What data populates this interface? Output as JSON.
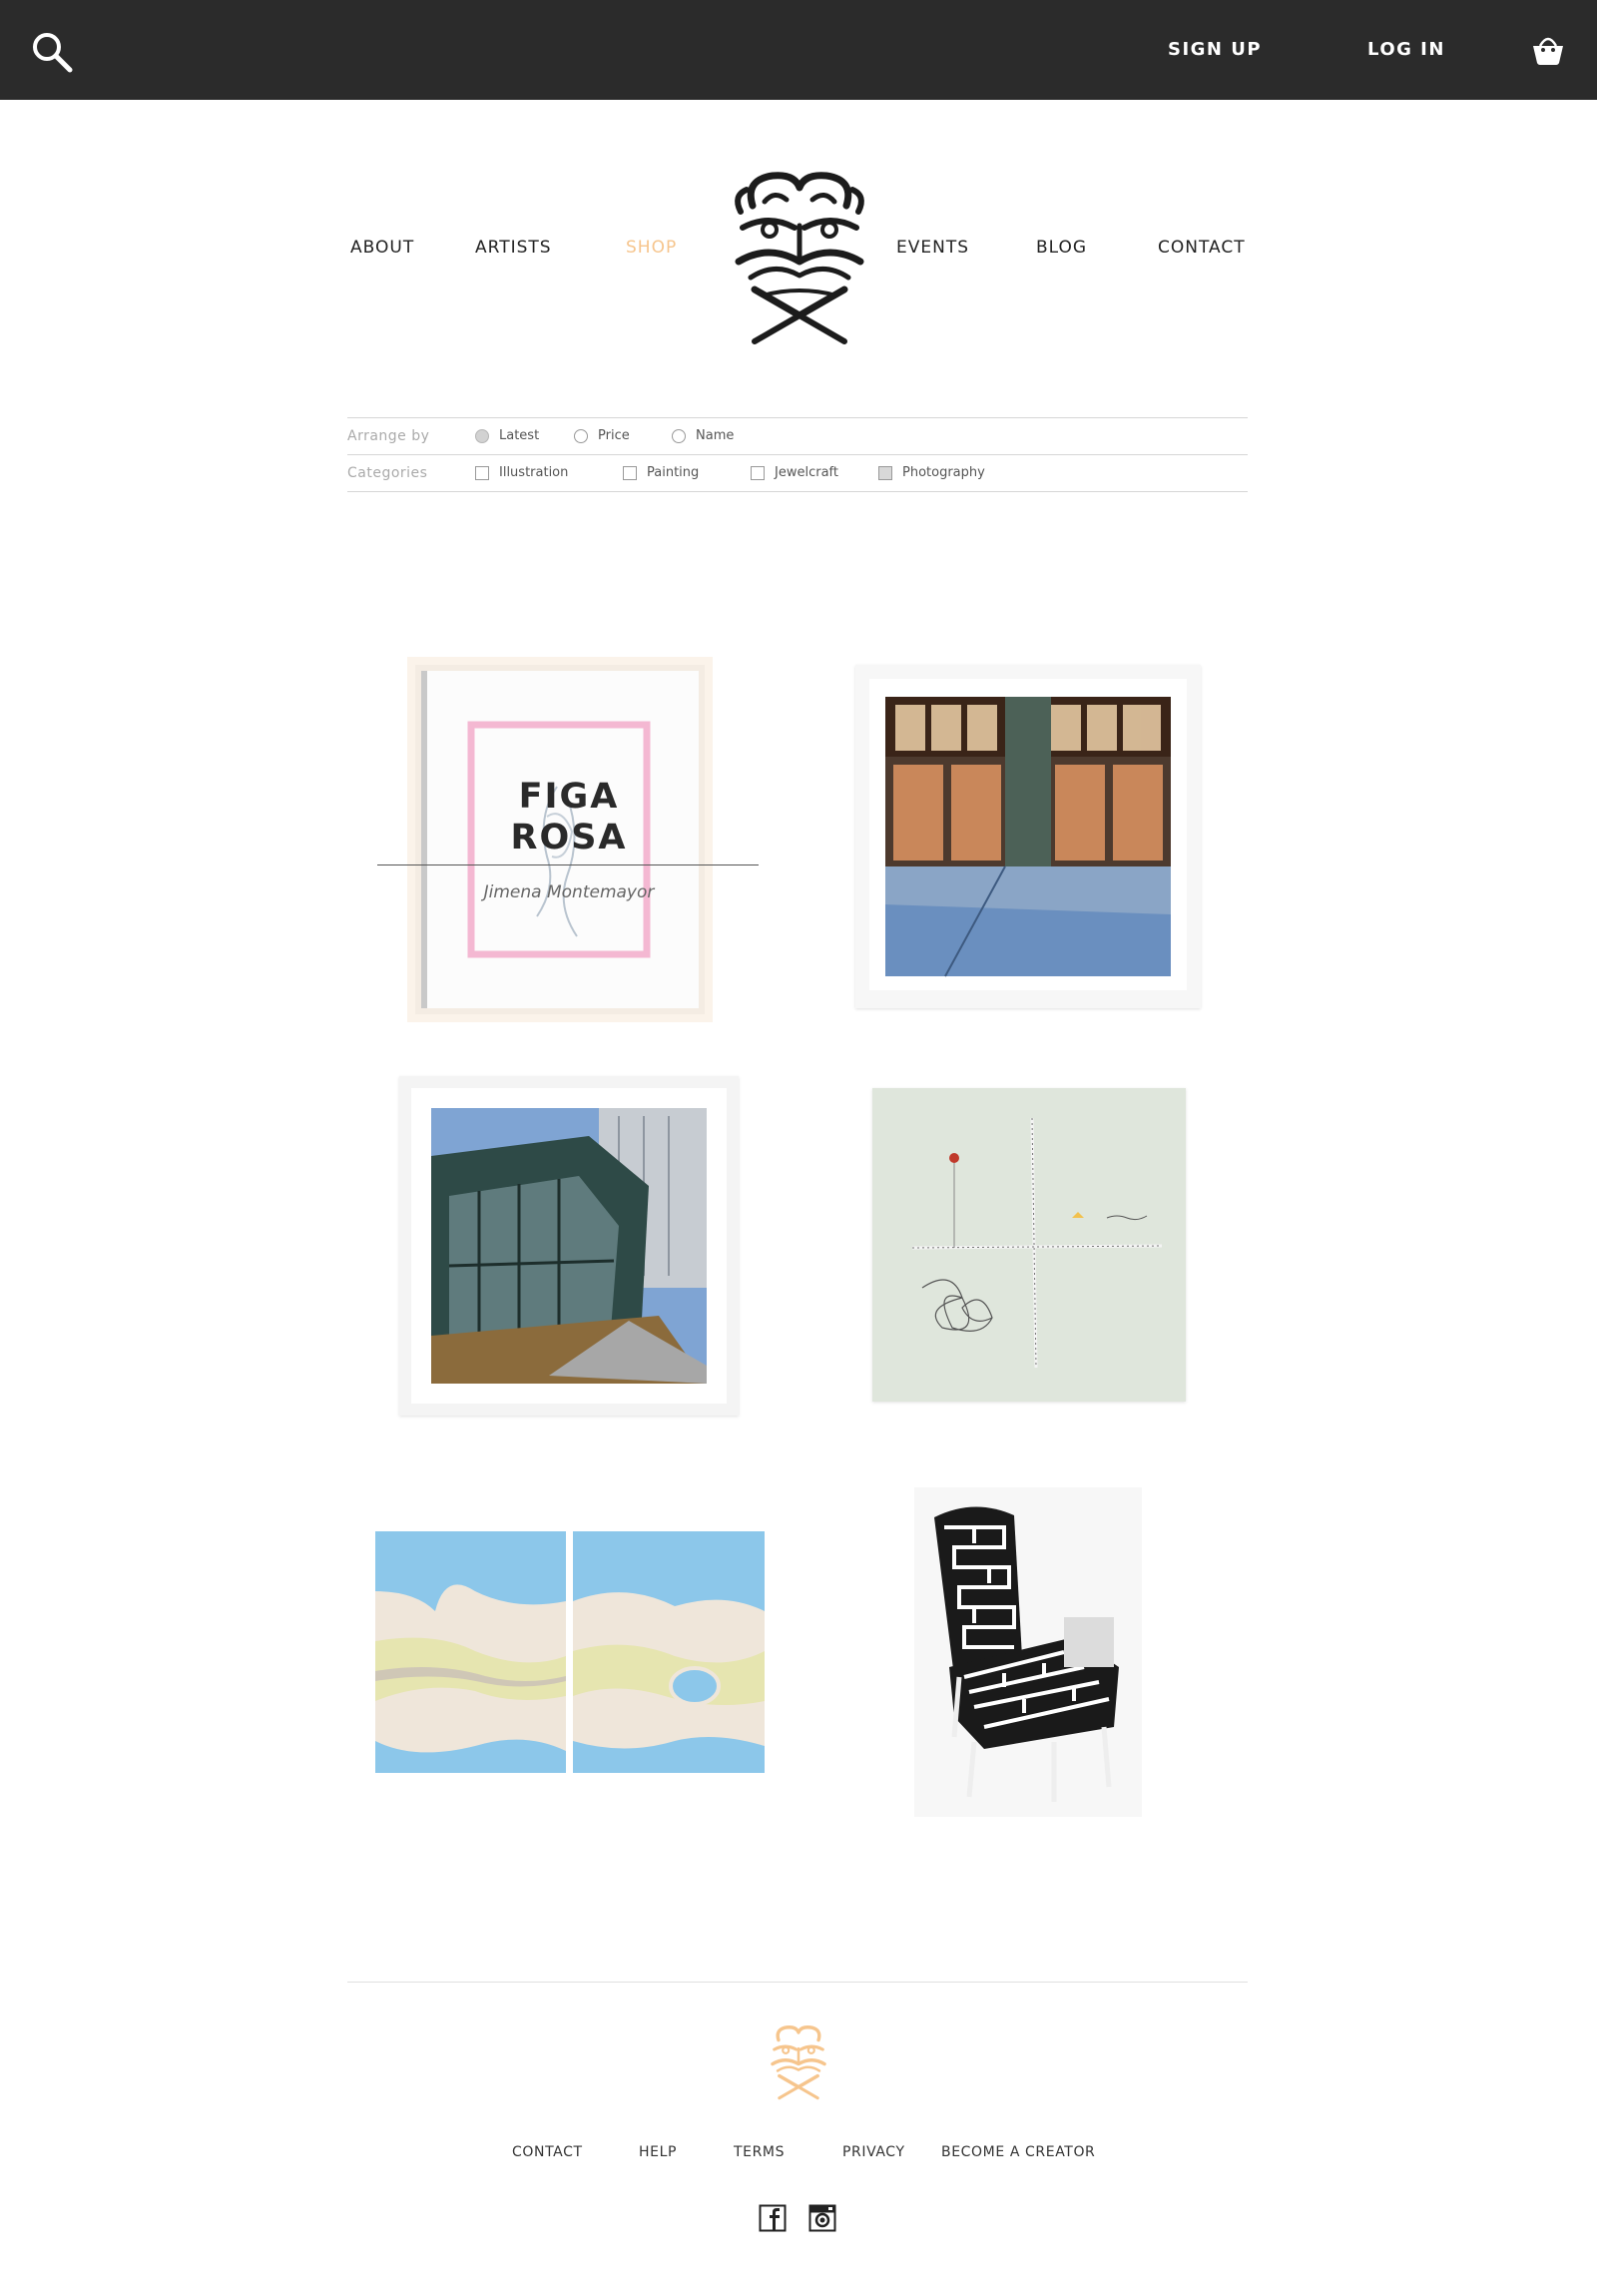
{
  "topbar": {
    "signup_label": "SIGN UP",
    "login_label": "LOG IN",
    "icons": [
      "search-icon",
      "basket-icon"
    ]
  },
  "nav": {
    "items": [
      "ABOUT",
      "ARTISTS",
      "SHOP",
      "EVENTS",
      "BLOG",
      "CONTACT"
    ],
    "active": "SHOP",
    "active_color": "#f6c58d"
  },
  "filters": {
    "arrange_label": "Arrange by",
    "arrange_options": [
      "Latest",
      "Price",
      "Name"
    ],
    "arrange_selected": "Latest",
    "categories_label": "Categories",
    "category_options": [
      "Illustration",
      "Painting",
      "Jewelcraft",
      "Photography"
    ],
    "category_checked": [
      "Photography"
    ]
  },
  "products": {
    "hovered": {
      "title_line1": "FIGA",
      "title_line2": "ROSA",
      "artist": "Jimena Montemayor"
    }
  },
  "footer": {
    "links": [
      "CONTACT",
      "HELP",
      "TERMS",
      "PRIVACY",
      "BECOME A CREATOR"
    ],
    "social_icons": [
      "facebook-icon",
      "instagram-icon"
    ],
    "logo_color": "#f6c58d"
  },
  "colors": {
    "topbar_bg": "#2b2b2b",
    "accent": "#f6c58d",
    "pink_mat": "#f4b8d2"
  }
}
